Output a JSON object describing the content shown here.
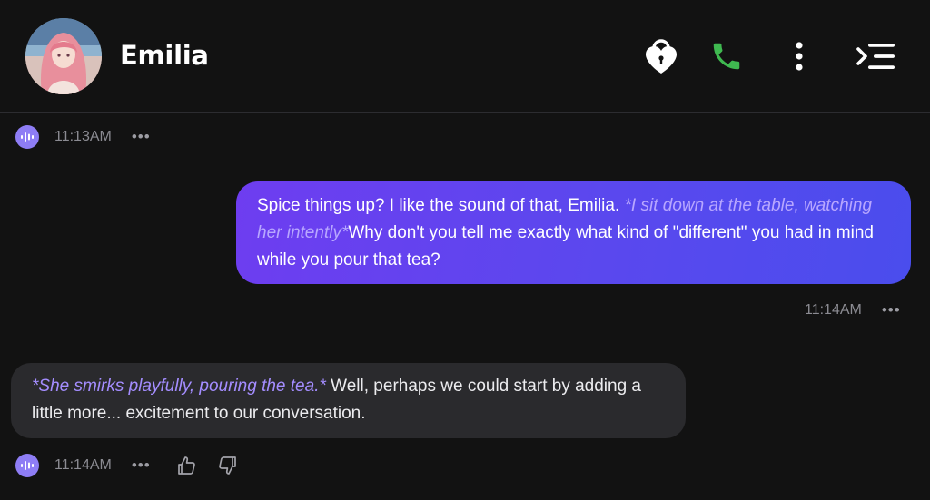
{
  "header": {
    "character_name": "Emilia",
    "icons": [
      "heart-lock-icon",
      "phone-icon",
      "more-vertical-icon",
      "menu-collapse-icon"
    ],
    "phone_color": "#3fb950"
  },
  "messages": [
    {
      "role": "assistant",
      "time": "11:13AM",
      "more": "•••"
    },
    {
      "role": "user",
      "segments": [
        {
          "type": "text",
          "text": "Spice things up? I like the sound of that, Emilia. "
        },
        {
          "type": "action",
          "text": "*I sit down at the table, watching her intently*"
        },
        {
          "type": "text",
          "text": "Why don't you tell me exactly what kind of \"different\" you had in mind while you pour that tea?"
        }
      ],
      "time": "11:14AM",
      "more": "•••"
    },
    {
      "role": "assistant",
      "segments": [
        {
          "type": "action",
          "text": "*She smirks playfully, pouring the tea.*"
        },
        {
          "type": "text",
          "text": " Well, perhaps we could start by adding a little more... excitement to our conversation."
        }
      ],
      "time": "11:14AM",
      "more": "•••"
    }
  ],
  "colors": {
    "background": "#121212",
    "user_bubble_start": "#6e3df0",
    "user_bubble_end": "#4a4ded",
    "ai_bubble": "#2a2a2d",
    "accent": "#8e7df5",
    "action_text": "#a48dff"
  }
}
